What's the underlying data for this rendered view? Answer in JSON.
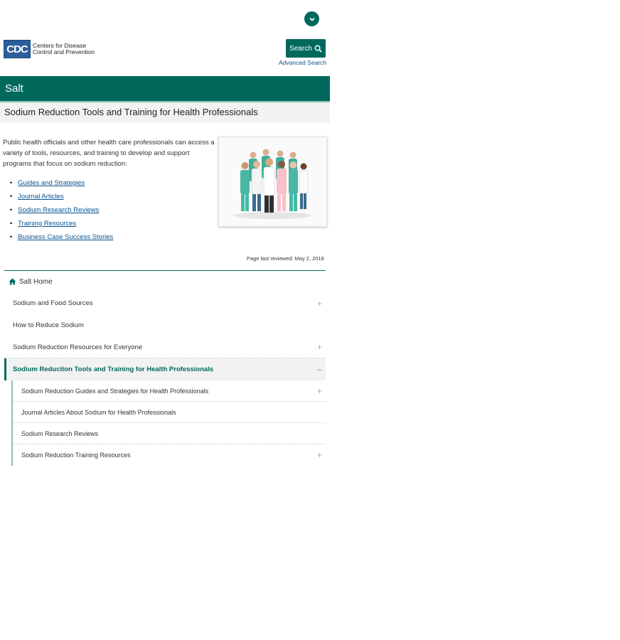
{
  "header": {
    "logo_abbr": "CDC",
    "logo_line1": "Centers for Disease",
    "logo_line2": "Control and Prevention",
    "search_label": "Search",
    "advanced_search": "Advanced Search"
  },
  "site_title": "Salt",
  "page_title": "Sodium Reduction Tools and Training for Health Professionals",
  "intro": "Public health officials and other health care professionals can access a variety of tools, resources, and training to develop and support programs that focus on sodium reduction:",
  "links": [
    {
      "label": "Guides and Strategies"
    },
    {
      "label": "Journal Articles"
    },
    {
      "label": "Sodium Research Reviews"
    },
    {
      "label": "Training Resources"
    },
    {
      "label": "Business Case Success Stories"
    }
  ],
  "last_reviewed": "Page last reviewed: May 2, 2018",
  "nav": {
    "home": "Salt Home",
    "items": [
      {
        "label": "Sodium and Food Sources",
        "toggle": "+"
      },
      {
        "label": "How to Reduce Sodium",
        "toggle": ""
      },
      {
        "label": "Sodium Reduction Resources for Everyone",
        "toggle": "+"
      },
      {
        "label": "Sodium Reduction Tools and Training for Health Professionals",
        "toggle": "−"
      }
    ],
    "sub_items": [
      {
        "label": "Sodium Reduction Guides and Strategies for Health Professionals",
        "toggle": "+"
      },
      {
        "label": "Journal Articles About Sodium for Health Professionals",
        "toggle": ""
      },
      {
        "label": "Sodium Research Reviews",
        "toggle": ""
      },
      {
        "label": "Sodium Reduction Training Resources",
        "toggle": "+"
      }
    ]
  },
  "colors": {
    "brand_green": "#00695c",
    "cdc_blue": "#2c5e9c",
    "link_blue": "#075290"
  }
}
